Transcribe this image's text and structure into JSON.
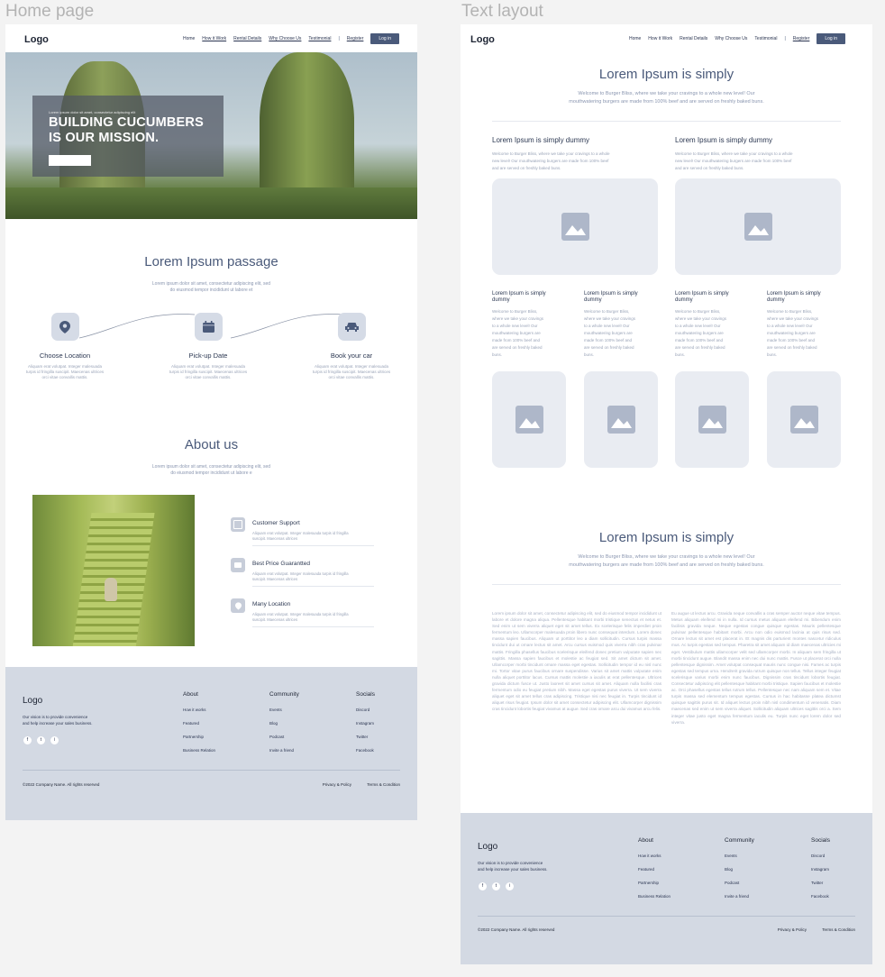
{
  "frames": {
    "home_label": "Home page",
    "text_label": "Text layout"
  },
  "nav": {
    "logo": "Logo",
    "links": [
      "Home",
      "How it Work",
      "Rental Details",
      "Why Choose Us",
      "Testimonial"
    ],
    "register": "Register",
    "login": "Log in"
  },
  "hero": {
    "small": "Lorem ipsum dolor sit amet, consectetur adipiscing elit",
    "title_line1": "BUILDING CUCUMBERS",
    "title_line2": "IS OUR MISSION."
  },
  "passage": {
    "title": "Lorem Ipsum passage",
    "sub1": "Lorem ipsum dolor sit amet, consectetur adipiscing elit, sed",
    "sub2": "do eiusmod tempor incididunt ut labore et"
  },
  "steps": [
    {
      "title": "Choose Location",
      "icon": "location-pin-icon",
      "desc1": "Aliquam erat volutpat. Integer malesuada",
      "desc2": "turpis id fringilla suscipit. Maecenas ultrices",
      "desc3": "orci vitae convallis mattis."
    },
    {
      "title": "Pick-up Date",
      "icon": "calendar-icon",
      "desc1": "Aliquam erat volutpat. Integer malesuada",
      "desc2": "turpis id fringilla suscipit. Maecenas ultrices",
      "desc3": "orci vitae convallis mattis."
    },
    {
      "title": "Book your car",
      "icon": "car-icon",
      "desc1": "Aliquam erat volutpat. Integer malesuada",
      "desc2": "turpis id fringilla suscipit. Maecenas ultrices",
      "desc3": "orci vitae convallis mattis."
    }
  ],
  "about": {
    "title": "About us",
    "sub1": "Lorem ipsum dolor sit amet, consectetur adipiscing elit, sed",
    "sub2": "do eiusmod tempor incididunt ut labore e",
    "features": [
      {
        "title": "Customer Support",
        "icon": "support-icon",
        "desc1": "Aliquam erat volutpat. Integer malesuada turpis id fringilla",
        "desc2": "suscipit. Maecenas ultrices"
      },
      {
        "title": "Best Price Guarantted",
        "icon": "price-tag-icon",
        "desc1": "Aliquam erat volutpat. Integer malesuada turpis id fringilla",
        "desc2": "suscipit. Maecenas ultrices"
      },
      {
        "title": "Many Location",
        "icon": "location-pin-icon",
        "desc1": "Aliquam erat volutpat. Integer malesuada turpis id fringilla",
        "desc2": "suscipit. Maecenas ultrices"
      }
    ]
  },
  "footer": {
    "logo": "Logo",
    "vision1": "Our vision is to provide convenience",
    "vision2": "and help increase your sales business.",
    "social_icons": [
      "f",
      "t",
      "i"
    ],
    "columns": [
      {
        "heading": "About",
        "items": [
          "How it works",
          "Featured",
          "Partnership",
          "Business Relation"
        ]
      },
      {
        "heading": "Community",
        "items": [
          "Events",
          "Blog",
          "Podcast",
          "Invite a friend"
        ]
      },
      {
        "heading": "Socials",
        "items": [
          "Discord",
          "Instagram",
          "Twitter",
          "Facebook"
        ]
      }
    ],
    "copyright": "©2022 Company Name. All rights reserved",
    "privacy": "Privacy & Policy",
    "terms": "Terms & Condition"
  },
  "text_layout": {
    "title1": "Lorem Ipsum is simply",
    "intro1": "Welcome to Burger Bliss, where we take your cravings to a whole new level! Our",
    "intro2": "mouthwatering burgers are made from 100% beef and are served on freshly baked buns.",
    "two_col": [
      {
        "heading": "Lorem Ipsum is simply dummy",
        "l1": "Welcome to Burger Bliss, where we take your cravings to a whole",
        "l2": "new level! Our mouthwatering burgers are made from 100% beef",
        "l3": "and are served on freshly baked buns."
      },
      {
        "heading": "Lorem Ipsum is simply dummy",
        "l1": "Welcome to Burger Bliss, where we take your cravings to a whole",
        "l2": "new level! Our mouthwatering burgers are made from 100% beef",
        "l3": "and are served on freshly baked buns."
      }
    ],
    "four_col": [
      {
        "h1": "Lorem Ipsum is simply",
        "h2": "dummy",
        "body": [
          "Welcome to Burger Bliss,",
          "where we take your cravings",
          "to a whole new level! Our",
          "mouthwatering burgers are",
          "made from 100% beef and",
          "are served on freshly baked",
          "buns."
        ]
      },
      {
        "h1": "Lorem Ipsum is simply",
        "h2": "dummy",
        "body": [
          "Welcome to Burger Bliss,",
          "where we take your cravings",
          "to a whole new level! Our",
          "mouthwatering burgers are",
          "made from 100% beef and",
          "are served on freshly baked",
          "buns."
        ]
      },
      {
        "h1": "Lorem Ipsum is simply",
        "h2": "dummy",
        "body": [
          "Welcome to Burger Bliss,",
          "where we take your cravings",
          "to a whole new level! Our",
          "mouthwatering burgers are",
          "made from 100% beef and",
          "are served on freshly baked",
          "buns."
        ]
      },
      {
        "h1": "Lorem Ipsum is simply",
        "h2": "dummy",
        "body": [
          "Welcome to Burger Bliss,",
          "where we take your cravings",
          "to a whole new level! Our",
          "mouthwatering burgers are",
          "made from 100% beef and",
          "are served on freshly baked",
          "buns."
        ]
      }
    ],
    "title2": "Lorem Ipsum is simply",
    "intro3": "Welcome to Burger Bliss, where we take your cravings to a whole new level! Our",
    "intro4": "mouthwatering burgers are made from 100% beef and are served on freshly baked buns.",
    "para_left": "Lorem ipsum dolor sit amet, consectetur adipiscing elit, sed do eiusmod tempor incididunt ut labore et dolore magna aliqua. Pellentesque habitant morbi tristique senectus et netus et. Sed enim ut sem viverra aliquet eget sit amet tellus. Ex scelerisque felis imperdiet proin fermentum leo. Ullamcorper malesuada proin libero nunc consequat interdum. Lorem donec massa sapien faucibus. Aliquam ut porttitor leo a diam sollicitudin. Cursus turpis massa tincidunt dui ut ornare lectus sit amet. Arcu cursus euismod quis viverra nibh cras pulvinar mattis. Fringilla phasellus faucibus scelerisque eleifend donec pretium vulputate sapien nec sagittis. Massa sapien faucibus et molestie ac feugiat sed. Sit amet dictum sit amet. Ullamcorper morbi tincidunt ornare massa eget egestas. Sollicitudin tempor id eu nisl nunc mi. Tortor vitae purus faucibus ornare suspendisse. Varius sit amet mattis vulputate enim nulla aliquet porttitor lacus. Cursus mattis molestie a iaculis at erat pellentesque. Ultrices gravida dictum fusce ut. Justo laoreet sit amet cursus sit amet. Aliquam nulla facilisi cras fermentum odio eu feugiat pretium nibh. Massa eget egestas purus viverra. Ut sem viverra aliquet eget sit amet tellus cras adipiscing. Tristique nisi nec feugiat in. Turpis tincidunt id aliquet risus feugiat. Ipsum dolor sit amet consectetur adipiscing elit. Ullamcorper dignissim cras tincidunt lobortis feugiat vivamus at augue. Sed cras ornare arcu dui vivamus arcu felis.",
    "para_right": "Eu augue ut lectus arcu. Gravida neque convallis a cras semper auctor neque vitae tempus. Metus aliquam eleifend mi in nulla. Id cursus metus aliquam eleifend mi. Bibendum enim facilisis gravida neque. Neque egestas congue quisque egestas. Mauris pellentesque pulvinar pellentesque habitant morbi. Arcu non odio euismod lacinia at quis risus sed. Ornare lectus sit amet est placerat in. Et magnis dis parturient montes nascetur ridiculus mus. Ac turpis egestas sed tempus. Pharetra sit amet aliquam id diam maecenas ultricies mi eget. Vestibulum mattis ullamcorper velit sed ullamcorper morbi. In aliquam sem fringilla ut morbi tincidunt augue. Blandit massa enim nec dui nunc mattis. Fusce ut placerat orci nulla pellentesque dignissim. Amet volutpat consequat mauris nunc congue nisi. Fames ac turpis egestas sed tempus urna. Hendrerit gravida rutrum quisque non tellus. Tellus integer feugiat scelerisque varius morbi enim nunc faucibus. Dignissim cras tincidunt lobortis feugiat. Consectetur adipiscing elit pellentesque habitant morbi tristique. Sapien faucibus et molestie ac. Orci phasellus egestas tellus rutrum tellus. Pellentesque nec nam aliquam sem et. Vitae turpis massa sed elementum tempus egestas. Cursus in hac habitasse platea dictumst quisque sagittis purus sit. Id aliquet lectus proin nibh nisl condimentum id venenatis. Diam maecenas sed enim ut sem viverra aliquet. Sollicitudin aliquam ultrices sagittis orci a. Sem integer vitae justo eget magna fermentum iaculis eu. Turpis nunc eget lorem dolor sed viverra."
  },
  "colors": {
    "accent": "#4a5a7a",
    "footer_bg": "#d3d9e3",
    "placeholder": "#e9ecf2"
  }
}
